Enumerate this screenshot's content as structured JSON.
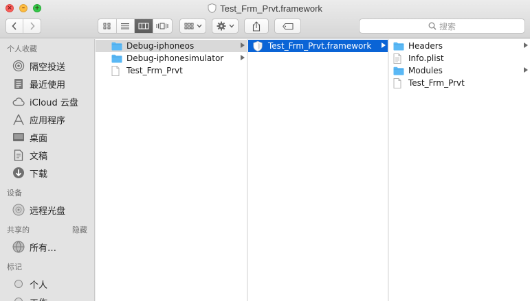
{
  "window": {
    "title": "Test_Frm_Prvt.framework"
  },
  "toolbar": {
    "back_icon": "chevron-left-icon",
    "forward_icon": "chevron-right-icon",
    "view_modes": [
      "icon-view",
      "list-view",
      "column-view",
      "cover-flow-view"
    ],
    "active_view": "column-view",
    "search_placeholder": "搜索"
  },
  "sidebar": {
    "sections": [
      {
        "title": "个人收藏",
        "items": [
          {
            "label": "隔空投送",
            "icon": "airdrop-icon"
          },
          {
            "label": "最近使用",
            "icon": "recents-icon"
          },
          {
            "label": "iCloud 云盘",
            "icon": "cloud-icon"
          },
          {
            "label": "应用程序",
            "icon": "applications-icon"
          },
          {
            "label": "桌面",
            "icon": "desktop-icon"
          },
          {
            "label": "文稿",
            "icon": "documents-icon"
          },
          {
            "label": "下载",
            "icon": "downloads-icon"
          }
        ]
      },
      {
        "title": "设备",
        "items": [
          {
            "label": "远程光盘",
            "icon": "remote-disc-icon"
          }
        ]
      },
      {
        "title": "共享的",
        "action": "隐藏",
        "items": [
          {
            "label": "所有…",
            "icon": "network-icon"
          }
        ]
      },
      {
        "title": "标记",
        "items": [
          {
            "label": "个人",
            "icon": "tag-circle-icon"
          },
          {
            "label": "工作",
            "icon": "tag-circle-icon"
          }
        ]
      }
    ]
  },
  "columns": {
    "col1": [
      {
        "name": "Debug-iphoneos",
        "type": "folder",
        "has_children": true,
        "state": "selected-inactive"
      },
      {
        "name": "Debug-iphonesimulator",
        "type": "folder",
        "has_children": true,
        "state": "normal"
      },
      {
        "name": "Test_Frm_Prvt",
        "type": "file",
        "has_children": false,
        "state": "normal"
      }
    ],
    "col2": [
      {
        "name": "Test_Frm_Prvt.framework",
        "type": "framework",
        "has_children": true,
        "state": "selected"
      }
    ],
    "col3": [
      {
        "name": "Headers",
        "type": "folder",
        "has_children": true,
        "state": "normal"
      },
      {
        "name": "Info.plist",
        "type": "plist",
        "has_children": false,
        "state": "normal"
      },
      {
        "name": "Modules",
        "type": "folder",
        "has_children": true,
        "state": "normal"
      },
      {
        "name": "Test_Frm_Prvt",
        "type": "file",
        "has_children": false,
        "state": "normal"
      }
    ]
  },
  "colors": {
    "selection_blue": "#0a64d6",
    "folder_blue": "#5ab8f5",
    "sidebar_bg": "#e3e3e3"
  }
}
